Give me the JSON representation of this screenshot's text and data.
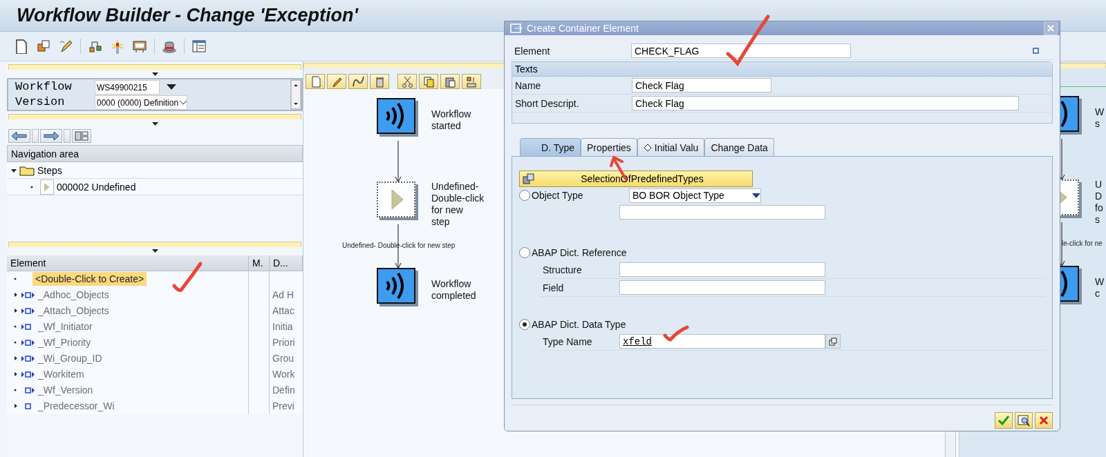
{
  "title": "Workflow Builder - Change 'Exception'",
  "workflow_fields": [
    {
      "label": "Workflow",
      "value": "WS49900215",
      "kind": "input"
    },
    {
      "label": "Version",
      "value": "0000 (0000) Definition",
      "kind": "select"
    }
  ],
  "navigation": {
    "title": "Navigation area",
    "tree": [
      {
        "label": "Steps",
        "expanded": true,
        "children": [
          {
            "label": "000002 Undefined"
          }
        ]
      }
    ]
  },
  "container": {
    "columns": [
      "Element",
      "M.",
      "D..."
    ],
    "create_row": "<Double-Click to Create>",
    "rows": [
      {
        "name": "_Adhoc_Objects",
        "description": "Ad H",
        "has_children": true,
        "import": true,
        "export": true
      },
      {
        "name": "_Attach_Objects",
        "description": "Attac",
        "has_children": true,
        "import": true,
        "export": true
      },
      {
        "name": "_Wf_Initiator",
        "description": "Initia",
        "has_children": false,
        "import": true,
        "export": false
      },
      {
        "name": "_Wf_Priority",
        "description": "Priori",
        "has_children": false,
        "import": true,
        "export": true
      },
      {
        "name": "_Wi_Group_ID",
        "description": "Grou",
        "has_children": true,
        "import": true,
        "export": true
      },
      {
        "name": "_Workitem",
        "description": "Work",
        "has_children": true,
        "import": true,
        "export": true
      },
      {
        "name": "_Wf_Version",
        "description": "Defin",
        "has_children": false,
        "import": false,
        "export": true
      },
      {
        "name": "_Predecessor_Wi",
        "description": "Previ",
        "has_children": true,
        "import": false,
        "export": false
      }
    ]
  },
  "diagram": {
    "nodes": [
      {
        "kind": "event",
        "label": "Workflow\nstarted"
      },
      {
        "kind": "undefined",
        "label": "Undefined-\nDouble-click\nfor new\nstep"
      },
      {
        "kind": "event",
        "label": "Workflow\ncompleted"
      }
    ],
    "edge_label": "Undefined- Double-click for new step"
  },
  "background_diagram": {
    "nodes": [
      {
        "kind": "event",
        "label": "W\ns"
      },
      {
        "kind": "undefined",
        "label": "U\nD\nfo\ns"
      },
      {
        "kind": "event",
        "label": "W\nc"
      }
    ],
    "edge_label": "le-click for ne"
  },
  "dialog": {
    "title": "Create Container Element",
    "element": {
      "label": "Element",
      "value": "CHECK_FLAG"
    },
    "texts": {
      "title": "Texts",
      "fields": [
        {
          "label": "Name",
          "value": "Check Flag"
        },
        {
          "label": "Short Descript.",
          "value": "Check Flag"
        }
      ]
    },
    "tabs": [
      {
        "label": "D. Type",
        "selected": true
      },
      {
        "label": "Properties",
        "selected": false
      },
      {
        "label": "Initial Valu",
        "selected": false
      },
      {
        "label": "Change Data",
        "selected": false
      }
    ],
    "type_button": "SelectionOfPredefinedTypes",
    "type_options": [
      {
        "label": "Object Type",
        "selected": false,
        "kind": "object",
        "dropdown": "BO BOR Object Type"
      },
      {
        "label": "ABAP Dict. Reference",
        "selected": false,
        "kind": "reference",
        "fields": [
          {
            "label": "Structure"
          },
          {
            "label": "Field"
          }
        ]
      },
      {
        "label": "ABAP Dict. Data Type",
        "selected": true,
        "kind": "reference",
        "fields": [
          {
            "label": "Type Name",
            "value": "xfeld",
            "kind": "value_help"
          }
        ]
      }
    ]
  }
}
